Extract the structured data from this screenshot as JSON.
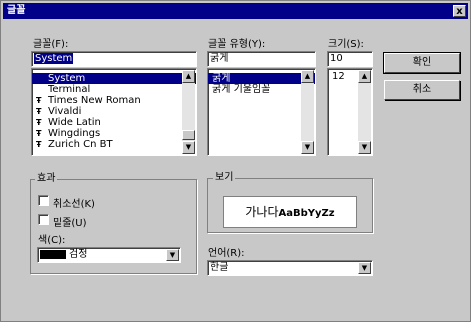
{
  "window": {
    "title": "글꼴",
    "close_label": "x"
  },
  "font": {
    "label": "글꼴(F):",
    "value": "System",
    "items": [
      {
        "label": "System",
        "icon": "none-icon",
        "selected": true
      },
      {
        "label": "Terminal",
        "icon": "none-icon",
        "selected": false
      },
      {
        "label": "Times New Roman",
        "icon": "truetype-icon",
        "selected": false
      },
      {
        "label": "Vivaldi",
        "icon": "truetype-icon",
        "selected": false
      },
      {
        "label": "Wide Latin",
        "icon": "truetype-icon",
        "selected": false
      },
      {
        "label": "Wingdings",
        "icon": "truetype-icon",
        "selected": false
      },
      {
        "label": "Zurich Cn BT",
        "icon": "truetype-icon",
        "selected": false
      }
    ]
  },
  "style": {
    "label": "글꼴 유형(Y):",
    "value": "굵게",
    "items": [
      {
        "label": "굵게",
        "selected": true
      },
      {
        "label": "굵게 기울임꼴",
        "selected": false
      }
    ]
  },
  "size": {
    "label": "크기(S):",
    "value": "10",
    "items": [
      {
        "label": "12",
        "selected": false
      }
    ]
  },
  "buttons": {
    "ok": "확인",
    "cancel": "취소"
  },
  "effects": {
    "title": "효과",
    "strikeout": "취소선(K)",
    "underline": "밑줄(U)",
    "color_label": "색(C):",
    "color_value": "검정"
  },
  "sample": {
    "title": "보기",
    "korean": "가나다",
    "latin": "AaBbYyZz"
  },
  "script": {
    "label": "언어(R):",
    "value": "한글"
  },
  "colors": {
    "face": "#c8c8c8",
    "title_bar": "#000088",
    "selection": "#000088"
  }
}
